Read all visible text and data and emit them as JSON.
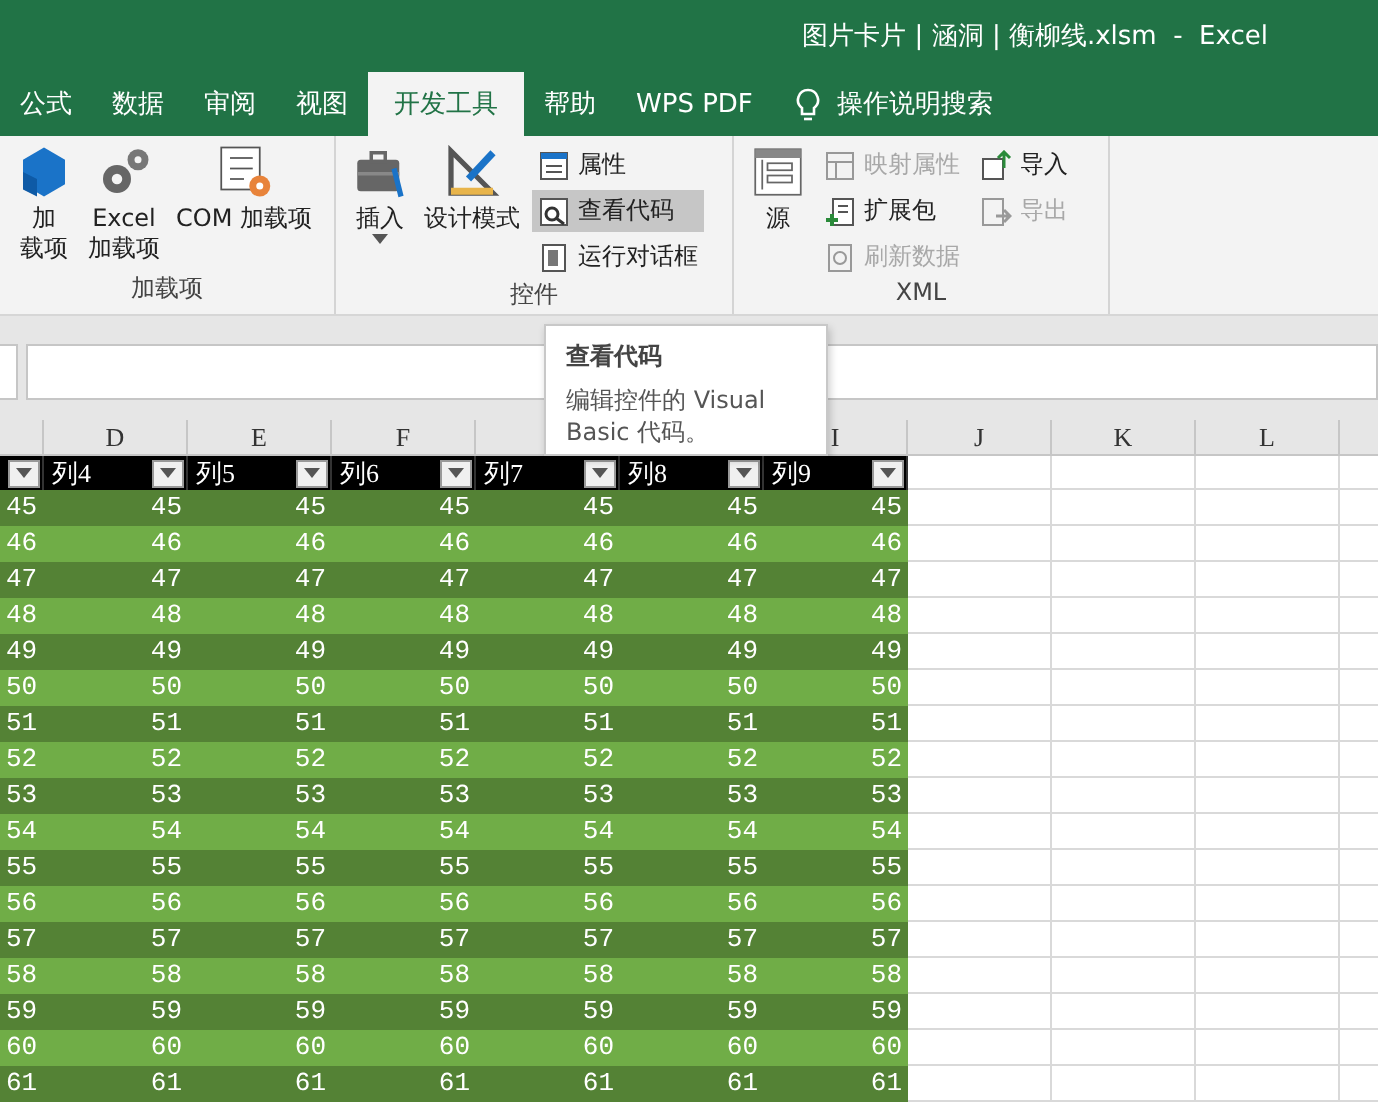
{
  "window": {
    "title": "图片卡片 | 涵洞 | 衡柳线.xlsm  -  Excel"
  },
  "tabs": [
    {
      "label": "公式",
      "selected": false
    },
    {
      "label": "数据",
      "selected": false
    },
    {
      "label": "审阅",
      "selected": false
    },
    {
      "label": "视图",
      "selected": false
    },
    {
      "label": "开发工具",
      "selected": true
    },
    {
      "label": "帮助",
      "selected": false
    },
    {
      "label": "WPS PDF",
      "selected": false
    }
  ],
  "tell_me": {
    "placeholder": "操作说明搜索"
  },
  "ribbon_groups": [
    {
      "label": "加载项",
      "large": [
        {
          "kind": "cube",
          "lines": [
            "加",
            "载项"
          ]
        },
        {
          "kind": "gears",
          "lines": [
            "Excel",
            "加载项"
          ]
        },
        {
          "kind": "com",
          "lines": [
            "COM 加载项"
          ]
        }
      ]
    },
    {
      "label": "控件",
      "large": [
        {
          "kind": "toolbox",
          "lines": [
            "插入"
          ],
          "dropdown": true
        },
        {
          "kind": "design",
          "lines": [
            "设计模式"
          ]
        }
      ],
      "small": [
        {
          "kind": "props",
          "label": "属性",
          "disabled": false,
          "selected": false
        },
        {
          "kind": "code",
          "label": "查看代码",
          "disabled": false,
          "selected": true
        },
        {
          "kind": "dialog",
          "label": "运行对话框",
          "disabled": false,
          "selected": false
        }
      ]
    },
    {
      "label": "XML",
      "large": [
        {
          "kind": "source",
          "lines": [
            "源"
          ]
        }
      ],
      "small": [
        {
          "kind": "map",
          "label": "映射属性",
          "disabled": true,
          "selected": false
        },
        {
          "kind": "pack",
          "label": "扩展包",
          "disabled": false,
          "selected": false
        },
        {
          "kind": "refresh",
          "label": "刷新数据",
          "disabled": true,
          "selected": false
        },
        {
          "kind": "import",
          "label": "导入",
          "disabled": false,
          "selected": false
        },
        {
          "kind": "export",
          "label": "导出",
          "disabled": true,
          "selected": false
        }
      ]
    }
  ],
  "column_headers": [
    "D",
    "E",
    "F",
    "I",
    "J",
    "K",
    "L"
  ],
  "table": {
    "columns": [
      "列4",
      "列5",
      "列6",
      "列7",
      "列8",
      "列9"
    ],
    "rows": [
      [
        "45",
        "45",
        "45",
        "45",
        "45",
        "45",
        "45"
      ],
      [
        "46",
        "46",
        "46",
        "46",
        "46",
        "46",
        "46"
      ],
      [
        "47",
        "47",
        "47",
        "47",
        "47",
        "47",
        "47"
      ],
      [
        "48",
        "48",
        "48",
        "48",
        "48",
        "48",
        "48"
      ],
      [
        "49",
        "49",
        "49",
        "49",
        "49",
        "49",
        "49"
      ],
      [
        "50",
        "50",
        "50",
        "50",
        "50",
        "50",
        "50"
      ],
      [
        "51",
        "51",
        "51",
        "51",
        "51",
        "51",
        "51"
      ],
      [
        "52",
        "52",
        "52",
        "52",
        "52",
        "52",
        "52"
      ],
      [
        "53",
        "53",
        "53",
        "53",
        "53",
        "53",
        "53"
      ],
      [
        "54",
        "54",
        "54",
        "54",
        "54",
        "54",
        "54"
      ],
      [
        "55",
        "55",
        "55",
        "55",
        "55",
        "55",
        "55"
      ],
      [
        "56",
        "56",
        "56",
        "56",
        "56",
        "56",
        "56"
      ],
      [
        "57",
        "57",
        "57",
        "57",
        "57",
        "57",
        "57"
      ],
      [
        "58",
        "58",
        "58",
        "58",
        "58",
        "58",
        "58"
      ],
      [
        "59",
        "59",
        "59",
        "59",
        "59",
        "59",
        "59"
      ],
      [
        "60",
        "60",
        "60",
        "60",
        "60",
        "60",
        "60"
      ],
      [
        "61",
        "61",
        "61",
        "61",
        "61",
        "61",
        "61"
      ]
    ]
  },
  "tooltip": {
    "title": "查看代码",
    "text": "编辑控件的 Visual Basic 代码。"
  }
}
